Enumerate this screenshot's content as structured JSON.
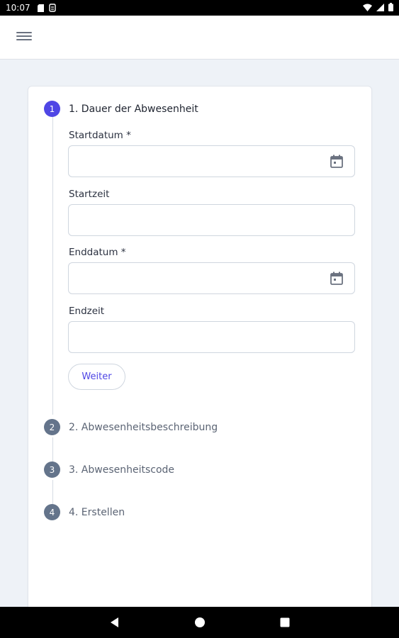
{
  "status_bar": {
    "time": "10:07",
    "icons_left": [
      "sd-card-icon",
      "notification-icon"
    ],
    "icons_right": [
      "wifi-icon",
      "cellular-icon",
      "battery-icon"
    ]
  },
  "app_bar": {
    "menu_icon": "hamburger-menu-icon"
  },
  "stepper": {
    "steps": [
      {
        "number": "1",
        "title": "1. Dauer der Abwesenheit",
        "active": true
      },
      {
        "number": "2",
        "title": "2. Abwesenheitsbeschreibung",
        "active": false
      },
      {
        "number": "3",
        "title": "3. Abwesenheitscode",
        "active": false
      },
      {
        "number": "4",
        "title": "4. Erstellen",
        "active": false
      }
    ]
  },
  "form": {
    "start_date": {
      "label": "Startdatum *",
      "value": "",
      "icon": "calendar-icon"
    },
    "start_time": {
      "label": "Startzeit",
      "value": ""
    },
    "end_date": {
      "label": "Enddatum *",
      "value": "",
      "icon": "calendar-icon"
    },
    "end_time": {
      "label": "Endzeit",
      "value": ""
    },
    "next_button": "Weiter"
  },
  "colors": {
    "accent": "#4f46e5",
    "inactive_step": "#64748b",
    "background": "#eef2f7"
  },
  "nav_bar": {
    "buttons": [
      "back-icon",
      "home-icon",
      "recents-icon"
    ]
  }
}
